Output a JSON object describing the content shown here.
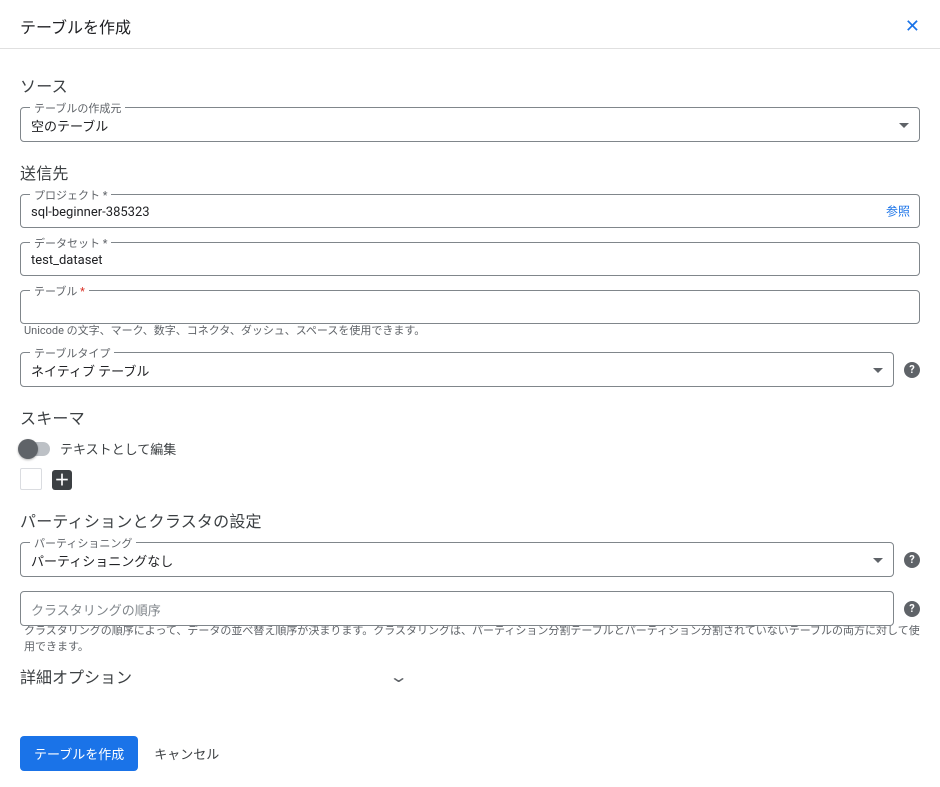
{
  "dialog": {
    "title": "テーブルを作成"
  },
  "source": {
    "heading": "ソース",
    "from_label": "テーブルの作成元",
    "from_value": "空のテーブル"
  },
  "destination": {
    "heading": "送信先",
    "project_label": "プロジェクト",
    "project_value": "sql-beginner-385323",
    "browse_label": "参照",
    "dataset_label": "データセット",
    "dataset_value": "test_dataset",
    "table_label": "テーブル",
    "table_value": "",
    "table_hint": "Unicode の文字、マーク、数字、コネクタ、ダッシュ、スペースを使用できます。",
    "tabletype_label": "テーブルタイプ",
    "tabletype_value": "ネイティブ テーブル"
  },
  "schema": {
    "heading": "スキーマ",
    "toggle_label": "テキストとして編集"
  },
  "partition": {
    "heading": "パーティションとクラスタの設定",
    "part_label": "パーティショニング",
    "part_value": "パーティショニングなし",
    "cluster_placeholder": "クラスタリングの順序",
    "cluster_hint": "クラスタリングの順序によって、データの並べ替え順序が決まります。クラスタリングは、パーティション分割テーブルとパーティション分割されていないテーブルの両方に対して使用できます。"
  },
  "advanced": {
    "heading": "詳細オプション"
  },
  "footer": {
    "create": "テーブルを作成",
    "cancel": "キャンセル"
  }
}
